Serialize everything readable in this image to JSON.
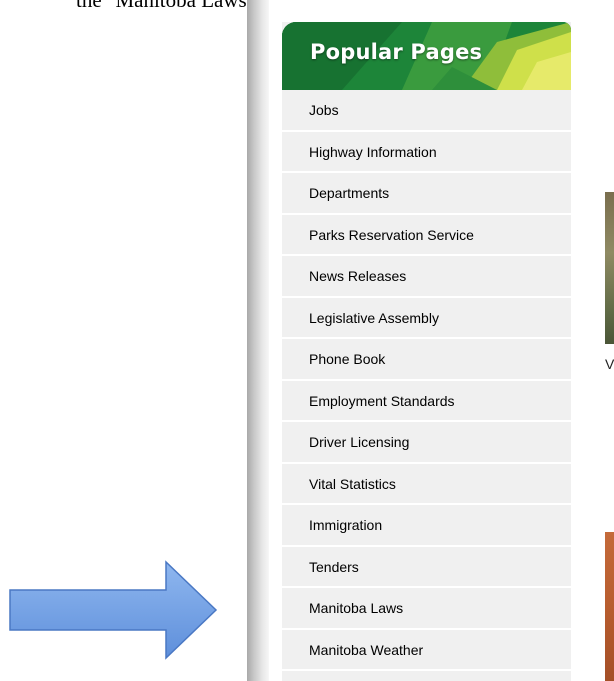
{
  "document": {
    "instruction_fragment": "the \"Manitoba Laws\" under the left-hand"
  },
  "sidebar": {
    "header_title": "Popular Pages",
    "items": [
      {
        "label": "Jobs"
      },
      {
        "label": "Highway Information"
      },
      {
        "label": "Departments"
      },
      {
        "label": "Parks Reservation Service"
      },
      {
        "label": "News Releases"
      },
      {
        "label": "Legislative Assembly"
      },
      {
        "label": "Phone Book"
      },
      {
        "label": "Employment Standards"
      },
      {
        "label": "Driver Licensing"
      },
      {
        "label": "Vital Statistics"
      },
      {
        "label": "Immigration"
      },
      {
        "label": "Tenders"
      },
      {
        "label": "Manitoba Laws"
      },
      {
        "label": "Manitoba Weather"
      }
    ]
  },
  "content": {
    "caption_fragment": "V"
  },
  "annotation": {
    "icon": "right-arrow-icon",
    "color": "#6f9ee2",
    "points_to": "Manitoba Laws"
  },
  "colors": {
    "header_green": "#1f8a3c",
    "header_yellow": "#cfe04a",
    "list_bg": "#f0f0f0"
  }
}
